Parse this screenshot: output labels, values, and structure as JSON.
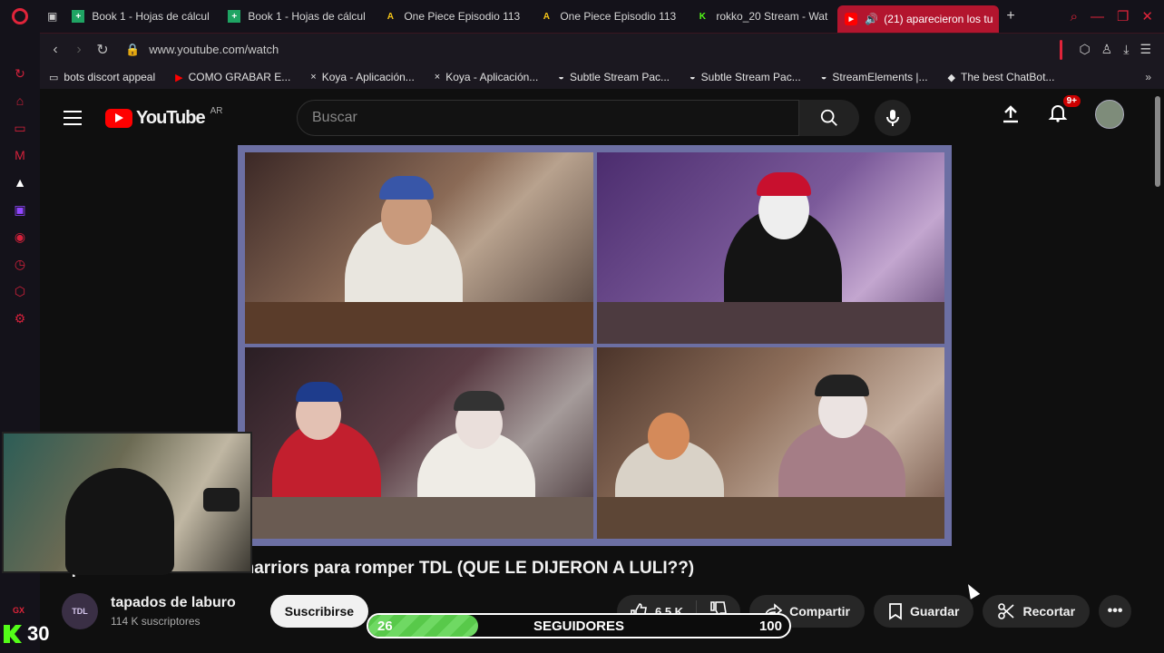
{
  "tabs": [
    {
      "label": "Book 1 - Hojas de cálcul",
      "icon": "sheets-icon"
    },
    {
      "label": "Book 1 - Hojas de cálcul",
      "icon": "sheets-icon"
    },
    {
      "label": "One Piece Episodio 113",
      "icon": "af-icon"
    },
    {
      "label": "One Piece Episodio 113",
      "icon": "af-icon"
    },
    {
      "label": "rokko_20 Stream - Wat",
      "icon": "kick-icon"
    },
    {
      "label": "(21) aparecieron los tu",
      "icon": "youtube-icon",
      "active": true
    }
  ],
  "address": {
    "url": "www.youtube.com/watch"
  },
  "bookmarks": [
    {
      "label": "bots discort appeal",
      "icon": "folder-icon"
    },
    {
      "label": "COMO GRABAR E...",
      "icon": "youtube-icon"
    },
    {
      "label": "Koya - Aplicación...",
      "icon": "x-icon"
    },
    {
      "label": "Koya - Aplicación...",
      "icon": "x-icon"
    },
    {
      "label": "Subtle Stream Pac...",
      "icon": "bag-icon"
    },
    {
      "label": "Subtle Stream Pac...",
      "icon": "bag-icon"
    },
    {
      "label": "StreamElements |...",
      "icon": "bag-icon"
    },
    {
      "label": "The best ChatBot...",
      "icon": "diamond-icon"
    }
  ],
  "youtube": {
    "logo_text": "YouTube",
    "country": "AR",
    "search_placeholder": "Buscar",
    "notifications": "9+",
    "video_title": "aparecieron los tusownarriors para romper TDL (QUE LE DIJERON A LULI??)",
    "channel": {
      "name": "tapados de laburo",
      "subs": "114 K suscriptores",
      "avatar_text": "TDL"
    },
    "subscribe": "Suscribirse",
    "likes": "6.5 K",
    "share": "Compartir",
    "save": "Guardar",
    "clip": "Recortar"
  },
  "overlay": {
    "kick_count": "30",
    "followers_label": "SEGUIDORES",
    "followers_current": "26",
    "followers_goal": "100",
    "followers_progress": 0.26,
    "gx": "GX"
  },
  "colors": {
    "accent": "#e0243a",
    "youtube_red": "#ff0000",
    "kick_green": "#53fc18"
  }
}
